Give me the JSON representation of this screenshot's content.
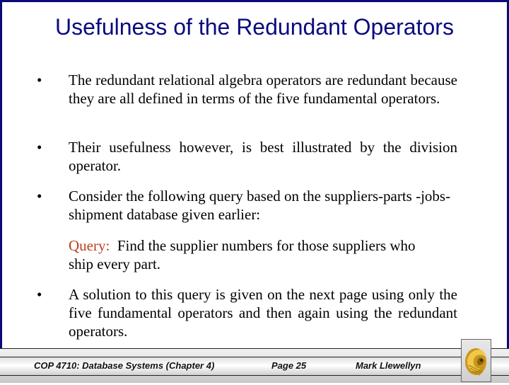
{
  "slide": {
    "title": "Usefulness of the Redundant Operators",
    "bullets": [
      {
        "symbol": "•",
        "text": "The redundant relational algebra operators are redundant because they are all defined in terms of the five fundamental operators."
      },
      {
        "symbol": "•",
        "text": "Their usefulness however, is best illustrated by the division operator."
      },
      {
        "symbol": "•",
        "text": "Consider the following query based on the suppliers-parts -jobs-shipment database given earlier:"
      },
      {
        "symbol": "•",
        "text": "A solution to this query is given on the next page using only the five fundamental operators and then again using the redundant operators."
      }
    ],
    "query": {
      "label": "Query:",
      "text": "Find the supplier numbers for those suppliers who ship every part."
    }
  },
  "footer": {
    "course": "COP 4710: Database Systems  (Chapter 4)",
    "page": "Page 25",
    "author": "Mark Llewellyn",
    "logo": "ucf-pegasus-logo"
  },
  "colors": {
    "frame": "#0a0a78",
    "title": "#0a0a80",
    "query_label": "#b8401e",
    "logo_gold": "#d4a017"
  }
}
